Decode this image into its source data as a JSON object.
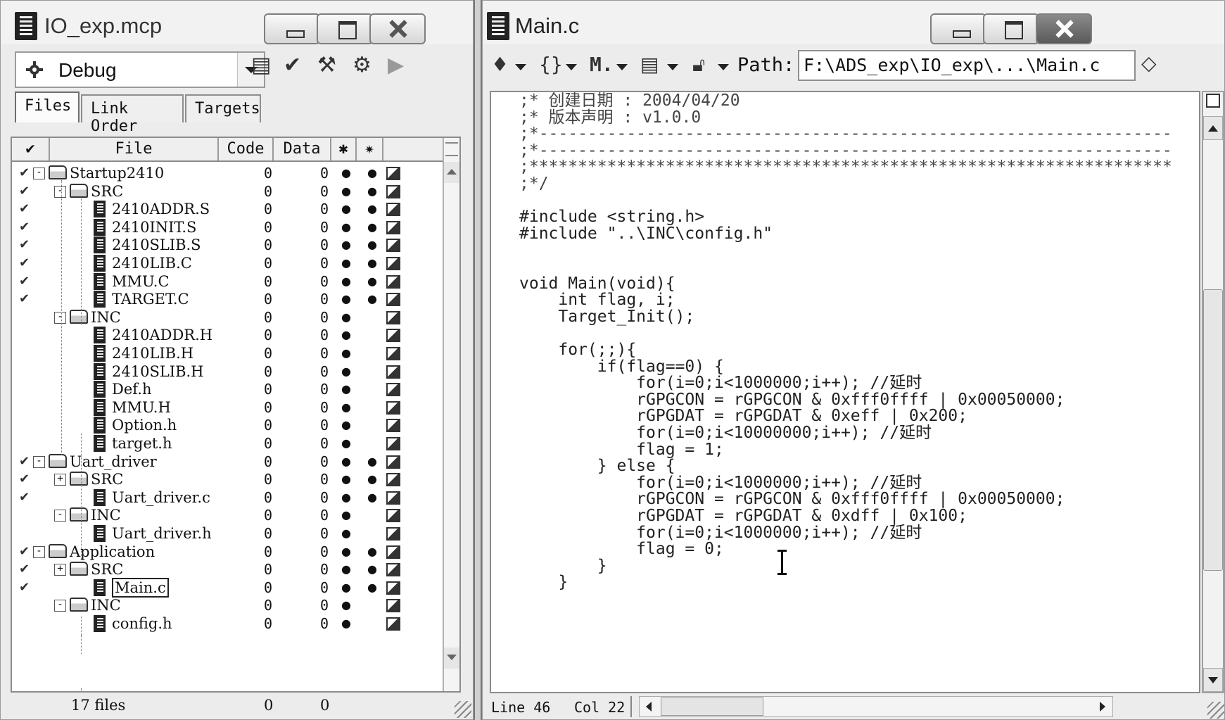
{
  "project_window": {
    "title": "IO_exp.mcp",
    "target_dropdown": "Debug",
    "tabs": [
      "Files",
      "Link Order",
      "Targets"
    ],
    "columns": {
      "file": "File",
      "code": "Code",
      "data": "Data"
    },
    "rows": [
      {
        "name": "Startup2410",
        "code": "0",
        "data": "0"
      },
      {
        "name": "SRC",
        "code": "0",
        "data": "0"
      },
      {
        "name": "2410ADDR.S",
        "code": "0",
        "data": "0"
      },
      {
        "name": "2410INIT.S",
        "code": "0",
        "data": "0"
      },
      {
        "name": "2410SLIB.S",
        "code": "0",
        "data": "0"
      },
      {
        "name": "2410LIB.C",
        "code": "0",
        "data": "0"
      },
      {
        "name": "MMU.C",
        "code": "0",
        "data": "0"
      },
      {
        "name": "TARGET.C",
        "code": "0",
        "data": "0"
      },
      {
        "name": "INC",
        "code": "0",
        "data": "0"
      },
      {
        "name": "2410ADDR.H",
        "code": "0",
        "data": "0"
      },
      {
        "name": "2410LIB.H",
        "code": "0",
        "data": "0"
      },
      {
        "name": "2410SLIB.H",
        "code": "0",
        "data": "0"
      },
      {
        "name": "Def.h",
        "code": "0",
        "data": "0"
      },
      {
        "name": "MMU.H",
        "code": "0",
        "data": "0"
      },
      {
        "name": "Option.h",
        "code": "0",
        "data": "0"
      },
      {
        "name": "target.h",
        "code": "0",
        "data": "0"
      },
      {
        "name": "Uart_driver",
        "code": "0",
        "data": "0"
      },
      {
        "name": "SRC",
        "code": "0",
        "data": "0"
      },
      {
        "name": "Uart_driver.c",
        "code": "0",
        "data": "0"
      },
      {
        "name": "INC",
        "code": "0",
        "data": "0"
      },
      {
        "name": "Uart_driver.h",
        "code": "0",
        "data": "0"
      },
      {
        "name": "Application",
        "code": "0",
        "data": "0"
      },
      {
        "name": "SRC",
        "code": "0",
        "data": "0"
      },
      {
        "name": "Main.c",
        "code": "0",
        "data": "0"
      },
      {
        "name": "INC",
        "code": "0",
        "data": "0"
      },
      {
        "name": "config.h",
        "code": "0",
        "data": "0"
      }
    ],
    "footer": {
      "files": "17 files",
      "code": "0",
      "data": "0"
    }
  },
  "editor_window": {
    "title": "Main.c",
    "path_label": "Path:",
    "path_value": "F:\\ADS_exp\\IO_exp\\...\\Main.c",
    "code_lines": [
      ";* 创建日期 : 2004/04/20",
      ";* 版本声明 : v1.0.0",
      ";*-----------------------------------------------------------------",
      ";*-----------------------------------------------------------------",
      ";******************************************************************",
      ";*/",
      "",
      "#include <string.h>",
      "#include \"..\\INC\\config.h\"",
      "",
      "",
      "void Main(void){",
      "    int flag, i;",
      "    Target_Init();",
      "",
      "    for(;;){",
      "        if(flag==0) {",
      "            for(i=0;i<1000000;i++); //延时",
      "            rGPGCON = rGPGCON & 0xfff0ffff | 0x00050000;",
      "            rGPGDAT = rGPGDAT & 0xeff | 0x200;",
      "            for(i=0;i<10000000;i++); //延时",
      "            flag = 1;",
      "        } else {",
      "            for(i=0;i<1000000;i++); //延时",
      "            rGPGCON = rGPGCON & 0xfff0ffff | 0x00050000;",
      "            rGPGDAT = rGPGDAT & 0xdff | 0x100;",
      "            for(i=0;i<1000000;i++); //延时",
      "            flag = 0;",
      "        }",
      "    }"
    ],
    "status": {
      "line": "Line 46",
      "col": "Col 22"
    }
  }
}
